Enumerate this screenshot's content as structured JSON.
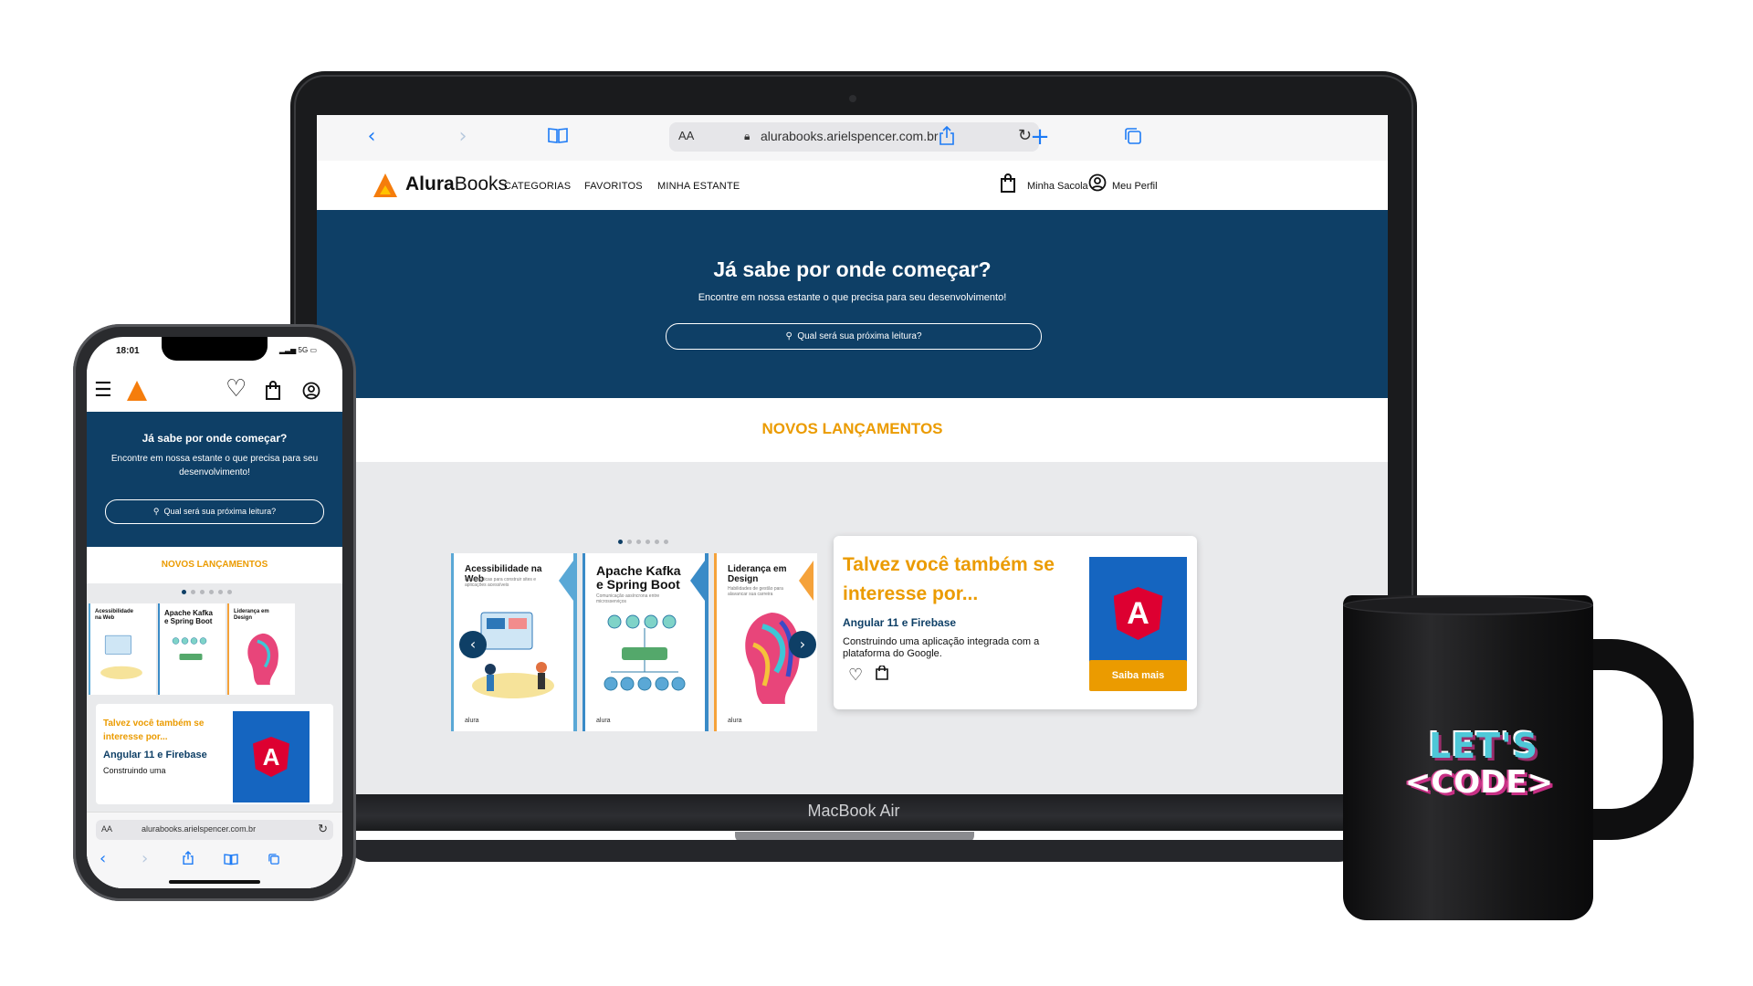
{
  "colors": {
    "navy": "#0e3f66",
    "accent": "#eb9b00",
    "logo_orange": "#f57d0c",
    "safari_blue": "#1d7bf6"
  },
  "safari": {
    "aa": "AA",
    "url": "alurabooks.arielspencer.com.br",
    "icons": [
      "chevron-left-icon",
      "chevron-right-icon",
      "book-icon",
      "lock-icon",
      "reload-icon",
      "share-icon",
      "plus-icon",
      "tabs-icon"
    ]
  },
  "site": {
    "logo": {
      "bold": "Alura",
      "light": "Books"
    },
    "nav": [
      "CATEGORIAS",
      "FAVORITOS",
      "MINHA ESTANTE"
    ],
    "bag_label": "Minha Sacola",
    "profile_label": "Meu Perfil",
    "hero": {
      "title": "Já sabe por onde começar?",
      "subtitle": "Encontre em nossa estante o que precisa para seu desenvolvimento!",
      "search_placeholder": "Qual será sua próxima leitura?"
    },
    "releases_title": "NOVOS LANÇAMENTOS",
    "books": [
      {
        "title": "Acessibilidade na Web",
        "subtitle": "Boas práticas para construir sites e aplicações acessíveis",
        "color": "#5aa8d6"
      },
      {
        "title": "Apache Kafka e Spring Boot",
        "subtitle": "Comunicação assíncrona entre microsserviços",
        "color": "#3a8bc7"
      },
      {
        "title": "Liderança em Design",
        "subtitle": "Habilidades de gestão para alavancar sua carreira",
        "color": "#f5a23a"
      }
    ],
    "book_publisher": "alura",
    "card": {
      "title": "Talvez você também se interesse por...",
      "book_title": "Angular 11 e Firebase",
      "description": "Construindo uma aplicação integrada com a plataforma do Google.",
      "cover_letter": "A",
      "button": "Saiba mais"
    }
  },
  "laptop": {
    "label": "MacBook Air"
  },
  "phone": {
    "time": "18:01",
    "status": "5G",
    "hero_title": "Já sabe por onde começar?",
    "hero_subtitle": "Encontre em nossa estante o que precisa para seu desenvolvimento!",
    "search_placeholder": "Qual será sua próxima leitura?",
    "releases_title": "NOVOS LANÇAMENTOS",
    "card_title": "Talvez você também se interesse por...",
    "card_book": "Angular 11 e Firebase",
    "card_desc": "Construindo uma",
    "url_aa": "AA",
    "url": "alurabooks.arielspencer.com.br"
  },
  "mug": {
    "line1": "LET'S",
    "line2": "<CODE>"
  }
}
